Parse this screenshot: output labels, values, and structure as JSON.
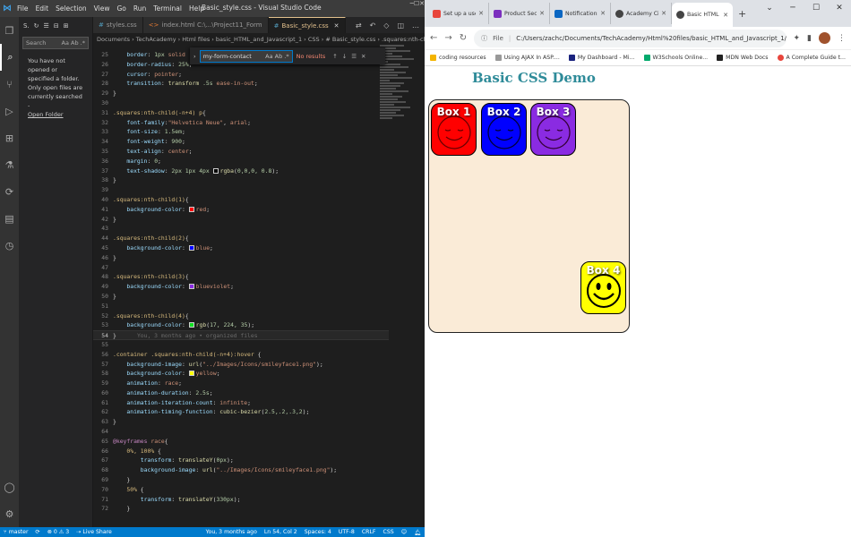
{
  "vscode": {
    "window_title": "Basic_style.css - Visual Studio Code",
    "menu": [
      "File",
      "Edit",
      "Selection",
      "View",
      "Go",
      "Run",
      "Terminal",
      "Help"
    ],
    "sidebar": {
      "header": "S.",
      "search_placeholder": "Search",
      "search_opts": "Aa Ab .*",
      "message": "You have not opened or specified a folder. Only open files are currently searched -",
      "link": "Open Folder"
    },
    "tabs": [
      {
        "label": "styles.css",
        "icon": "#"
      },
      {
        "label": "index.html  C:\\...\\Project11_Form",
        "icon": "<>"
      },
      {
        "label": "Basic_style.css",
        "icon": "#",
        "active": true
      }
    ],
    "breadcrumbs": "Documents › TechAcademy › Html files › basic_HTML_and_Javascript_1 › CSS › # Basic_style.css › .squares:nth-child(4)",
    "find": {
      "value": "my-form-contact",
      "options": "Aa Ab .*",
      "result": "No results"
    },
    "status": {
      "branch": "master",
      "problems": "⊗ 0 ⚠ 3",
      "live_share": "Live Share",
      "blame": "You, 3 months ago",
      "position": "Ln 54, Col 2",
      "spaces": "Spaces: 4",
      "encoding": "UTF-8",
      "eol": "CRLF",
      "lang": "CSS"
    },
    "code": [
      {
        "n": "25",
        "html": "    <span class=\"prop\">border</span>: <span class=\"num\">1px</span> <span class=\"val\">solid</span>"
      },
      {
        "n": "26",
        "html": "    <span class=\"prop\">border-radius</span>: <span class=\"num\">25%</span>;"
      },
      {
        "n": "27",
        "html": "    <span class=\"prop\">cursor</span>: <span class=\"val\">pointer</span>;"
      },
      {
        "n": "28",
        "html": "    <span class=\"prop\">transition</span>: <span class=\"fn\">transform</span> <span class=\"num\">.5s</span> <span class=\"val\">ease-in-out</span>;"
      },
      {
        "n": "29",
        "html": "}"
      },
      {
        "n": "30",
        "html": ""
      },
      {
        "n": "31",
        "html": "<span class=\"sel\">.squares:nth-child(-n+4) p</span>{"
      },
      {
        "n": "32",
        "html": "    <span class=\"prop\">font-family</span>:<span class=\"val\">\"Helvetica Neue\"</span>, <span class=\"val\">arial</span>;"
      },
      {
        "n": "33",
        "html": "    <span class=\"prop\">font-size</span>: <span class=\"num\">1.5em</span>;"
      },
      {
        "n": "34",
        "html": "    <span class=\"prop\">font-weight</span>: <span class=\"num\">900</span>;"
      },
      {
        "n": "35",
        "html": "    <span class=\"prop\">text-align</span>: <span class=\"val\">center</span>;"
      },
      {
        "n": "36",
        "html": "    <span class=\"prop\">margin</span>: <span class=\"num\">0</span>;"
      },
      {
        "n": "37",
        "html": "    <span class=\"prop\">text-shadow</span>: <span class=\"num\">2px 1px 4px</span> <span class=\"swatch\" style=\"background:rgba(0,0,0,0.8)\"></span><span class=\"fn\">rgba</span>(<span class=\"num\">0,0,0, 0.8</span>);"
      },
      {
        "n": "38",
        "html": "}"
      },
      {
        "n": "39",
        "html": ""
      },
      {
        "n": "40",
        "html": "<span class=\"sel\">.squares:nth-child(1)</span>{"
      },
      {
        "n": "41",
        "html": "    <span class=\"prop\">background-color</span>: <span class=\"swatch\" style=\"background:#f00\"></span><span class=\"val\">red</span>;"
      },
      {
        "n": "42",
        "html": "}"
      },
      {
        "n": "43",
        "html": ""
      },
      {
        "n": "44",
        "html": "<span class=\"sel\">.squares:nth-child(2)</span>{"
      },
      {
        "n": "45",
        "html": "    <span class=\"prop\">background-color</span>: <span class=\"swatch\" style=\"background:#00f\"></span><span class=\"val\">blue</span>;"
      },
      {
        "n": "46",
        "html": "}"
      },
      {
        "n": "47",
        "html": ""
      },
      {
        "n": "48",
        "html": "<span class=\"sel\">.squares:nth-child(3)</span>{"
      },
      {
        "n": "49",
        "html": "    <span class=\"prop\">background-color</span>: <span class=\"swatch\" style=\"background:#8a2be2\"></span><span class=\"val\">blueviolet</span>;"
      },
      {
        "n": "50",
        "html": "}"
      },
      {
        "n": "51",
        "html": ""
      },
      {
        "n": "52",
        "html": "<span class=\"sel\">.squares:nth-child(4)</span>{"
      },
      {
        "n": "53",
        "html": "    <span class=\"prop\">background-color</span>: <span class=\"swatch\" style=\"background:rgb(17,224,35)\"></span><span class=\"fn\">rgb</span>(<span class=\"num\">17, 224, 35</span>);"
      },
      {
        "n": "54",
        "html": "}      <span class=\"blame\">You, 3 months ago • organized files</span>",
        "current": true
      },
      {
        "n": "55",
        "html": ""
      },
      {
        "n": "56",
        "html": "<span class=\"sel\">.container .squares:nth-child(-n+4):hover</span> {"
      },
      {
        "n": "57",
        "html": "    <span class=\"prop\">background-image</span>: <span class=\"fn\">url</span>(<span class=\"val\">\"../Images/Icons/smileyface1.png\"</span>);"
      },
      {
        "n": "58",
        "html": "    <span class=\"prop\">background-color</span>: <span class=\"swatch\" style=\"background:#ff0\"></span><span class=\"val\">yellow</span>;"
      },
      {
        "n": "59",
        "html": "    <span class=\"prop\">animation</span>: <span class=\"val\">race</span>;"
      },
      {
        "n": "60",
        "html": "    <span class=\"prop\">animation-duration</span>: <span class=\"num\">2.5s</span>;"
      },
      {
        "n": "61",
        "html": "    <span class=\"prop\">animation-iteration-count</span>: <span class=\"val\">infinite</span>;"
      },
      {
        "n": "62",
        "html": "    <span class=\"prop\">animation-timing-function</span>: <span class=\"fn\">cubic-bezier</span>(<span class=\"num\">2.5,.2,.3,2</span>);"
      },
      {
        "n": "63",
        "html": "}"
      },
      {
        "n": "64",
        "html": ""
      },
      {
        "n": "65",
        "html": "<span class=\"kw\">@keyframes</span> <span class=\"val\">race</span>{"
      },
      {
        "n": "66",
        "html": "    <span class=\"sel\">0%, 100%</span> {"
      },
      {
        "n": "67",
        "html": "        <span class=\"prop\">transform</span>: <span class=\"fn\">translateY</span>(<span class=\"num\">0px</span>);"
      },
      {
        "n": "68",
        "html": "        <span class=\"prop\">background-image</span>: <span class=\"fn\">url</span>(<span class=\"val\">\"../Images/Icons/smileyface1.png\"</span>);"
      },
      {
        "n": "69",
        "html": "    }"
      },
      {
        "n": "70",
        "html": "    <span class=\"sel\">50%</span> {"
      },
      {
        "n": "71",
        "html": "        <span class=\"prop\">transform</span>: <span class=\"fn\">translateY</span>(<span class=\"num\">330px</span>);"
      },
      {
        "n": "72",
        "html": "    }"
      }
    ]
  },
  "chrome": {
    "tabs": [
      {
        "label": "Set up a user n",
        "fav_color": "#e8453c"
      },
      {
        "label": "Product Securi",
        "fav_color": "#7b2fbe"
      },
      {
        "label": "Notifications |",
        "fav_color": "#0a66c2"
      },
      {
        "label": "Academy Cinem",
        "fav_color": "#444444"
      },
      {
        "label": "Basic HTML Te",
        "fav_color": "#444444",
        "active": true
      }
    ],
    "omnibox_label": "File",
    "url": "C:/Users/zachc/Documents/TechAcademy/Html%20files/basic_HTML_and_Javascript_1/Project/...",
    "bookmarks": [
      {
        "label": "coding resources",
        "color": "#f4b400"
      },
      {
        "label": "Using AJAX In ASP....",
        "color": "#999999"
      },
      {
        "label": "My Dashboard - Mi...",
        "color": "#1a237e"
      },
      {
        "label": "W3Schools Online...",
        "color": "#04aa6d"
      },
      {
        "label": "MDN Web Docs",
        "color": "#222222"
      },
      {
        "label": "A Complete Guide t...",
        "color": "#e8453c"
      }
    ],
    "page": {
      "title": "Basic CSS Demo",
      "boxes": [
        {
          "label": "Box 1",
          "color": "#ff0000"
        },
        {
          "label": "Box 2",
          "color": "#0000ff"
        },
        {
          "label": "Box 3",
          "color": "#8a2be2"
        },
        {
          "label": "Box 4",
          "color": "#ffff00"
        }
      ]
    }
  }
}
